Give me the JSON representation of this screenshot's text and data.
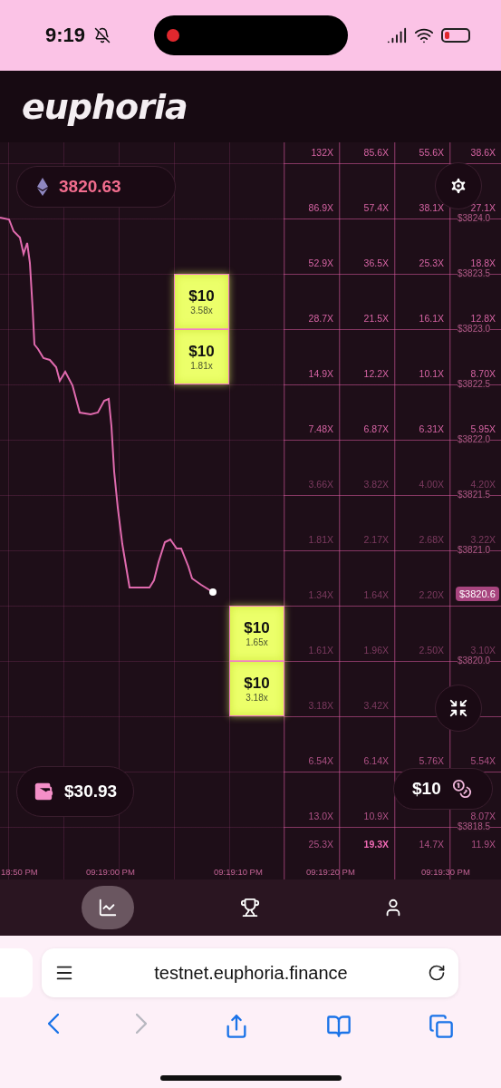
{
  "status_bar": {
    "time": "9:19"
  },
  "header": {
    "logo": "euphoria"
  },
  "price": {
    "value": "3820.63"
  },
  "grid": {
    "rows": [
      {
        "multipliers": [
          "132X",
          "85.6X",
          "55.6X",
          "38.6X"
        ]
      },
      {
        "multipliers": [
          "86.9X",
          "57.4X",
          "38.1X",
          "27.1X"
        ],
        "price": "$3824.0"
      },
      {
        "multipliers": [
          "52.9X",
          "36.5X",
          "25.3X",
          "18.8X"
        ],
        "price": "$3823.5"
      },
      {
        "multipliers": [
          "28.7X",
          "21.5X",
          "16.1X",
          "12.8X"
        ],
        "price": "$3823.0"
      },
      {
        "multipliers": [
          "14.9X",
          "12.2X",
          "10.1X",
          "8.70X"
        ],
        "price": "$3822.5"
      },
      {
        "multipliers": [
          "7.48X",
          "6.87X",
          "6.31X",
          "5.95X"
        ],
        "price": "$3822.0"
      },
      {
        "multipliers": [
          "3.66X",
          "3.82X",
          "4.00X",
          "4.20X"
        ],
        "price": "$3821.5"
      },
      {
        "multipliers": [
          "1.81X",
          "2.17X",
          "2.68X",
          "3.22X"
        ],
        "price": "$3821.0"
      },
      {
        "multipliers": {
          "col_1": "1.34X",
          "col_2": "1.64X",
          "col_3": "2.20X"
        }
      },
      {
        "multipliers": [
          "1.61X",
          "1.96X",
          "2.50X",
          "3.10X"
        ],
        "price": "$3820.0"
      },
      {
        "multipliers": {
          "col_1": "3.18X",
          "col_2": "3.42X"
        }
      },
      {
        "multipliers": [
          "6.54X",
          "6.14X",
          "5.76X",
          "5.54X"
        ]
      },
      {
        "multipliers": {
          "col_1": "13.0X",
          "col_2": "10.9X",
          "col_4": "8.07X"
        },
        "price": "$3818.5"
      },
      {
        "multipliers": [
          "25.3X",
          "19.3X",
          "14.7X",
          "11.9X"
        ]
      }
    ],
    "current_price": "$3820.6",
    "times": [
      "18:50 PM",
      "09:19:00 PM",
      "09:19:10 PM",
      "09:19:20 PM",
      "09:19:30 PM"
    ]
  },
  "bets": [
    {
      "amount": "$10",
      "multiplier": "3.58x"
    },
    {
      "amount": "$10",
      "multiplier": "1.81x"
    },
    {
      "amount": "$10",
      "multiplier": "1.65x"
    },
    {
      "amount": "$10",
      "multiplier": "3.18x"
    }
  ],
  "wallet": {
    "balance": "$30.93"
  },
  "bet_size": {
    "amount": "$10"
  },
  "nav": [
    {
      "kind": "chart",
      "selected": true
    },
    {
      "kind": "trophy",
      "selected": false
    },
    {
      "kind": "user",
      "selected": false
    }
  ],
  "browser": {
    "url": "testnet.euphoria.finance",
    "forward_disabled": true
  }
}
